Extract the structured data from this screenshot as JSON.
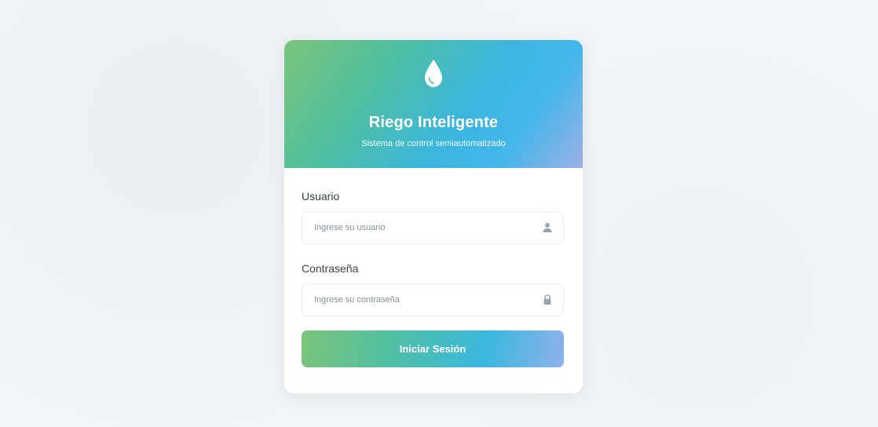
{
  "brand": {
    "title": "Riego Inteligente",
    "subtitle": "Sistema de control semiautomatizado",
    "icon": "water-drop-icon"
  },
  "form": {
    "username": {
      "label": "Usuario",
      "placeholder": "Ingrese su usuario",
      "value": "",
      "icon": "user-icon"
    },
    "password": {
      "label": "Contraseña",
      "placeholder": "Ingrese su contraseña",
      "value": "",
      "icon": "lock-icon"
    },
    "submit_label": "Iniciar Sesión"
  },
  "colors": {
    "gradient_start": "#7cc47a",
    "gradient_mid": "#3bb6e0",
    "gradient_end": "#9db0e6",
    "text": "#3a4148",
    "icon": "#9aa3ad"
  }
}
